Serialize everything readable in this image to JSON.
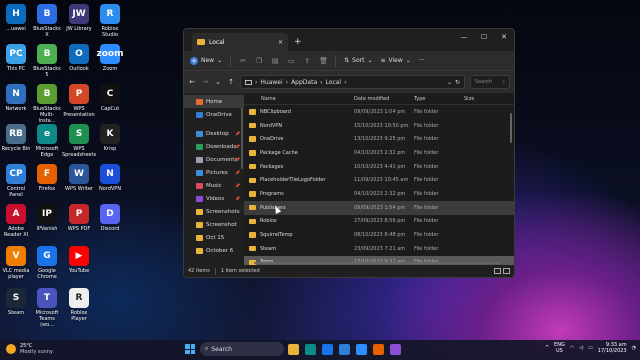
{
  "desktop": {
    "icons": [
      {
        "label": "...uawei",
        "color": "#0a6cbf",
        "glyph": "H"
      },
      {
        "label": "BlueStacks X",
        "color": "#2b6de3",
        "glyph": "B"
      },
      {
        "label": "JW Library",
        "color": "#3e3a7a",
        "glyph": "JW"
      },
      {
        "label": "Roblox Studio",
        "color": "#2d8cf0",
        "glyph": "R"
      },
      {
        "label": "This PC",
        "color": "#3aa0e8",
        "glyph": "PC"
      },
      {
        "label": "BlueStacks 5",
        "color": "#4caf50",
        "glyph": "B"
      },
      {
        "label": "Outlook",
        "color": "#0f6cbd",
        "glyph": "O"
      },
      {
        "label": "Zoom",
        "color": "#2d8cff",
        "glyph": "zoom"
      },
      {
        "label": "Network",
        "color": "#2f6fbf",
        "glyph": "N"
      },
      {
        "label": "BlueStacks Multi-Insta...",
        "color": "#5a9e2f",
        "glyph": "B"
      },
      {
        "label": "WPS Presentation",
        "color": "#d24726",
        "glyph": "P"
      },
      {
        "label": "CapCut",
        "color": "#111111",
        "glyph": "C"
      },
      {
        "label": "Recycle Bin",
        "color": "#4a6d8c",
        "glyph": "RB"
      },
      {
        "label": "Microsoft Edge",
        "color": "#0c8b88",
        "glyph": "e"
      },
      {
        "label": "WPS Spreadsheets",
        "color": "#1d8f4e",
        "glyph": "S"
      },
      {
        "label": "Krisp",
        "color": "#222222",
        "glyph": "K"
      },
      {
        "label": "Control Panel",
        "color": "#2f7ed8",
        "glyph": "CP"
      },
      {
        "label": "Firefox",
        "color": "#e66000",
        "glyph": "F"
      },
      {
        "label": "WPS Writer",
        "color": "#2b579a",
        "glyph": "W"
      },
      {
        "label": "NordVPN",
        "color": "#1c4fd8",
        "glyph": "N"
      },
      {
        "label": "Adobe Reader XI",
        "color": "#c8102e",
        "glyph": "A"
      },
      {
        "label": "IPVanish",
        "color": "#111111",
        "glyph": "IP"
      },
      {
        "label": "WPS PDF",
        "color": "#c62828",
        "glyph": "P"
      },
      {
        "label": "Discord",
        "color": "#5865f2",
        "glyph": "D"
      },
      {
        "label": "VLC media player",
        "color": "#ef7d00",
        "glyph": "V"
      },
      {
        "label": "Google Chrome",
        "color": "#1a73e8",
        "glyph": "G"
      },
      {
        "label": "YouTube",
        "color": "#ff0000",
        "glyph": "▶"
      },
      {
        "label": "Steam",
        "color": "#1b2838",
        "glyph": "S"
      },
      {
        "label": "Microsoft Teams (wo...",
        "color": "#4b53bc",
        "glyph": "T"
      },
      {
        "label": "Roblox Player",
        "color": "#eeeeee",
        "glyph": "R"
      }
    ]
  },
  "window": {
    "tab_title": "Local",
    "toolbar": {
      "new_label": "New",
      "sort_label": "Sort",
      "view_label": "View",
      "more_label": "···"
    },
    "address": {
      "crumbs": [
        "Huawei",
        "AppData",
        "Local"
      ],
      "search_placeholder": "Search"
    },
    "sidebar": {
      "items": [
        {
          "label": "Home",
          "color": "#e86a2e",
          "selected": true,
          "pinned": false
        },
        {
          "label": "OneDrive",
          "color": "#2f7ed8",
          "selected": false,
          "pinned": false
        },
        {
          "label": "Desktop",
          "color": "#3a8fd6",
          "selected": false,
          "pinned": true
        },
        {
          "label": "Downloads",
          "color": "#2f9e5a",
          "selected": false,
          "pinned": true
        },
        {
          "label": "Documents",
          "color": "#9aa3b0",
          "selected": false,
          "pinned": true
        },
        {
          "label": "Pictures",
          "color": "#3a8fd6",
          "selected": false,
          "pinned": true
        },
        {
          "label": "Music",
          "color": "#e04a5a",
          "selected": false,
          "pinned": true
        },
        {
          "label": "Videos",
          "color": "#8a4fd6",
          "selected": false,
          "pinned": true
        },
        {
          "label": "Screenshots",
          "color": "#e8b53a",
          "selected": false,
          "pinned": false
        },
        {
          "label": "Screenshot",
          "color": "#e8b53a",
          "selected": false,
          "pinned": false
        },
        {
          "label": "Oct 15",
          "color": "#e8b53a",
          "selected": false,
          "pinned": false
        },
        {
          "label": "October 6",
          "color": "#e8b53a",
          "selected": false,
          "pinned": false
        }
      ]
    },
    "columns": {
      "name": "Name",
      "date": "Date modified",
      "type": "Type",
      "size": "Size"
    },
    "rows": [
      {
        "name": "NBClipboard",
        "date": "09/09/2023 1:04 pm",
        "type": "File folder",
        "state": ""
      },
      {
        "name": "NordVPN",
        "date": "15/10/2023 10:50 pm",
        "type": "File folder",
        "state": ""
      },
      {
        "name": "OneDrive",
        "date": "13/10/2023 9:25 pm",
        "type": "File folder",
        "state": ""
      },
      {
        "name": "Package Cache",
        "date": "04/10/2023 2:32 pm",
        "type": "File folder",
        "state": ""
      },
      {
        "name": "Packages",
        "date": "10/10/2023 4:41 pm",
        "type": "File folder",
        "state": ""
      },
      {
        "name": "PlaceholderTileLogoFolder",
        "date": "11/09/2023 10:45 am",
        "type": "File folder",
        "state": ""
      },
      {
        "name": "Programs",
        "date": "04/10/2023 2:32 pm",
        "type": "File folder",
        "state": ""
      },
      {
        "name": "Publishers",
        "date": "09/09/2023 1:54 pm",
        "type": "File folder",
        "state": "hover"
      },
      {
        "name": "Roblox",
        "date": "27/09/2023 8:56 pm",
        "type": "File folder",
        "state": ""
      },
      {
        "name": "SquirrelTemp",
        "date": "08/10/2023 8:48 pm",
        "type": "File folder",
        "state": ""
      },
      {
        "name": "Steam",
        "date": "23/09/2023 7:21 am",
        "type": "File folder",
        "state": ""
      },
      {
        "name": "Temp",
        "date": "17/10/2023 9:32 am",
        "type": "File folder",
        "state": "sel"
      }
    ],
    "status": {
      "count": "42 items",
      "selection": "1 item selected"
    }
  },
  "taskbar": {
    "weather_temp": "25°C",
    "weather_desc": "Mostly sunny",
    "search_placeholder": "Search",
    "apps": [
      {
        "name": "file-explorer",
        "color": "#e8b53a"
      },
      {
        "name": "edge",
        "color": "#0c8b88"
      },
      {
        "name": "chrome",
        "color": "#1a73e8"
      },
      {
        "name": "store",
        "color": "#2f7ed8"
      },
      {
        "name": "zoom",
        "color": "#2d8cff"
      },
      {
        "name": "firefox",
        "color": "#e66000"
      },
      {
        "name": "photos",
        "color": "#8a4fd6"
      }
    ],
    "lang_line1": "ENG",
    "lang_line2": "US",
    "time": "9:33 am",
    "date": "17/10/2023"
  }
}
